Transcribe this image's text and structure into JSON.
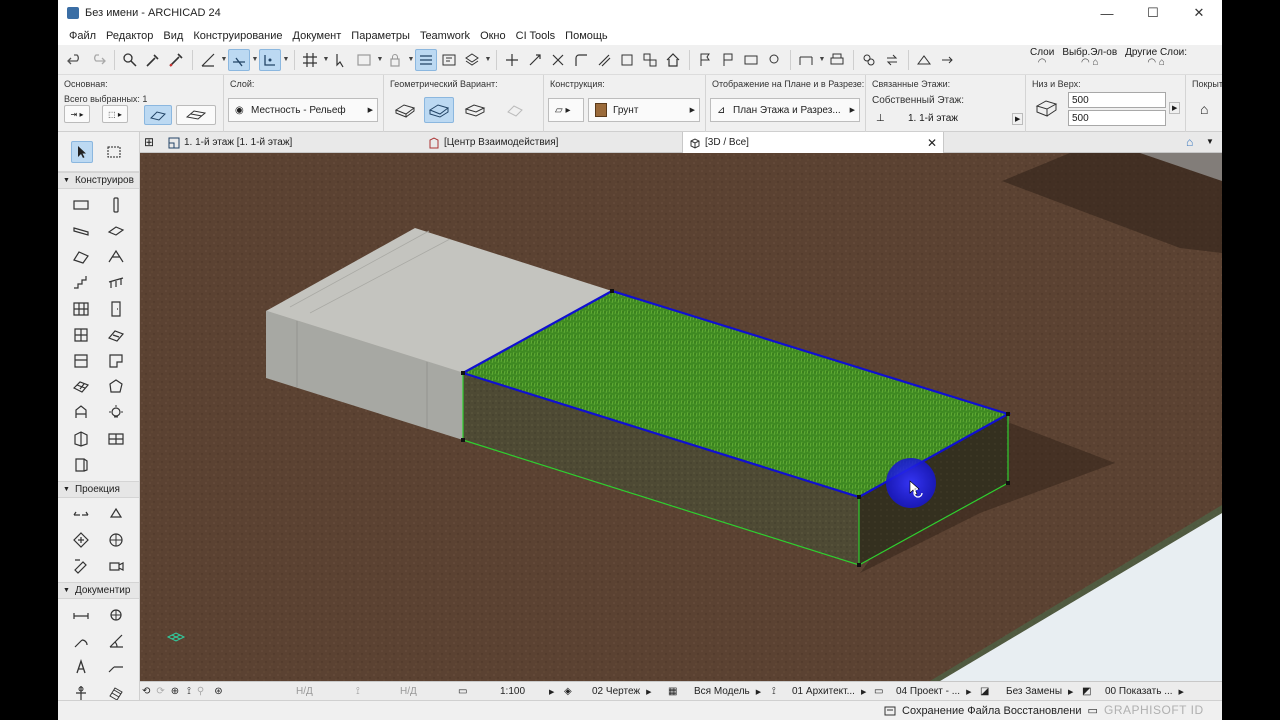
{
  "window": {
    "title": "Без имени - ARCHICAD 24",
    "controls": [
      "—",
      "☐",
      "✕"
    ]
  },
  "menu": [
    "Файл",
    "Редактор",
    "Вид",
    "Конструирование",
    "Документ",
    "Параметры",
    "Teamwork",
    "Окно",
    "CI Tools",
    "Помощь"
  ],
  "toolbar": {
    "layers_labels": [
      "Слои",
      "Выбр.Эл-ов",
      "Другие Слои:"
    ]
  },
  "infobox": {
    "main": {
      "label": "Основная:",
      "selected": "Всего выбранных: 1"
    },
    "layer": {
      "label": "Слой:",
      "value": "Местность - Рельеф"
    },
    "geometry": {
      "label": "Геометрический Вариант:"
    },
    "construction": {
      "label": "Конструкция:",
      "value": "Грунт"
    },
    "display": {
      "label": "Отображение на Плане и в Разрезе:",
      "value": "План Этажа и Разрез..."
    },
    "linked": {
      "label": "Связанные Этажи:",
      "home": "Собственный Этаж:",
      "story": "1. 1-й этаж"
    },
    "bottom_top": {
      "label": "Низ и Верх:",
      "top": "500",
      "bottom": "500"
    },
    "cover": {
      "label": "Покрыт"
    }
  },
  "toolbox": {
    "sections": [
      {
        "title": "Конструиров",
        "tools": [
          "wall-tool-icon",
          "column-tool-icon",
          "beam-tool-icon",
          "slab-tool-icon",
          "roof-tool-icon",
          "shell-tool-icon",
          "stair-tool-icon",
          "railing-tool-icon",
          "curtain-wall-tool-icon",
          "door-tool-icon",
          "window-tool-icon",
          "skylight-tool-icon",
          "opening-tool-icon",
          "zone-tool-icon",
          "mesh-tool-icon",
          "morph-tool-icon",
          "object-tool-icon",
          "lamp-tool-icon",
          "corner-window-icon",
          "wall-end-icon",
          "freeform-tool-icon"
        ]
      },
      {
        "title": "Проекция",
        "tools": [
          "section-tool-icon",
          "elevation-tool-icon",
          "interior-elevation-icon",
          "worksheet-tool-icon",
          "detail-tool-icon",
          "camera-tool-icon"
        ]
      },
      {
        "title": "Документир",
        "tools": [
          "dimension-tool-icon",
          "level-dimension-icon",
          "radial-dimension-icon",
          "angle-dimension-icon",
          "text-tool-icon",
          "label-tool-icon",
          "elevation-marker-icon",
          "fill-tool-icon"
        ]
      }
    ]
  },
  "tabs": [
    {
      "label": "1. 1-й этаж [1. 1-й этаж]"
    },
    {
      "label": "[Центр Взаимодействия]"
    },
    {
      "label": "[3D / Все]",
      "close": "✕"
    }
  ],
  "viewbar": {
    "nd1": "Н/Д",
    "nd2": "Н/Д",
    "scale": "1:100",
    "layer_combo": "02 Чертеж",
    "model_view": "Вся Модель",
    "pen_set": "01 Архитект...",
    "graphic_override": "04 Проект - ...",
    "renovation": "Без Замены",
    "show": "00 Показать ..."
  },
  "status": {
    "message": "Сохранение Файла Восстановлени",
    "brand": "GRAPHISOFT ID"
  },
  "colors": {
    "selection": "#1010d0",
    "ground": "#5a4030",
    "grass": "#3f8a22",
    "concrete": "#b8b8b2"
  }
}
